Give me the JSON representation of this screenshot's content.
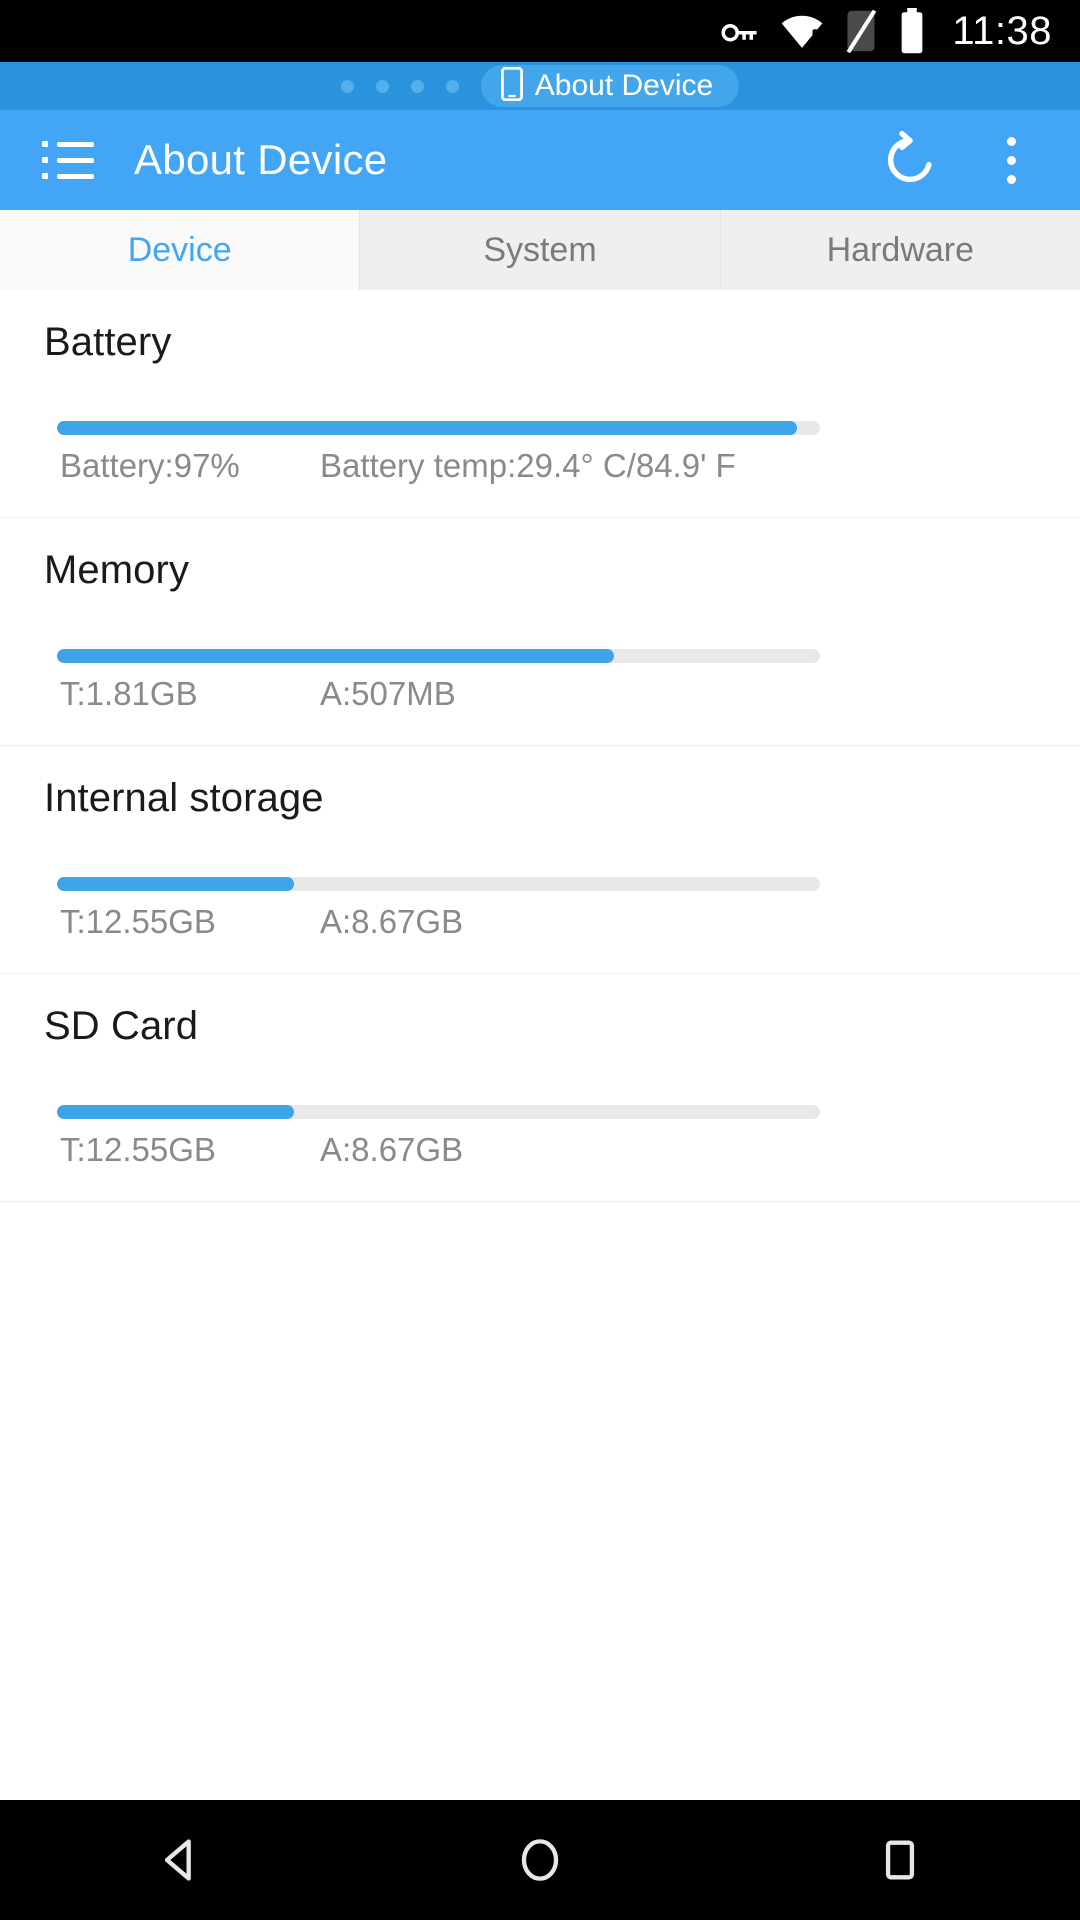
{
  "status_bar": {
    "time": "11:38",
    "icons": [
      "vpn-key-icon",
      "wifi-warning-icon",
      "sim-missing-icon",
      "battery-full-icon"
    ]
  },
  "pill_bar": {
    "dots_count": 4,
    "active_pill": {
      "label": "About Device",
      "icon": "phone-icon"
    }
  },
  "app_bar": {
    "title": "About Device",
    "menu_icon": "list-menu-icon",
    "refresh_icon": "refresh-icon",
    "overflow_icon": "more-vert-icon",
    "accent_color": "#42a5f5"
  },
  "tabs": [
    {
      "label": "Device",
      "selected": true
    },
    {
      "label": "System",
      "selected": false
    },
    {
      "label": "Hardware",
      "selected": false
    }
  ],
  "sections": [
    {
      "title": "Battery",
      "progress_percent": 97,
      "stat_left": "Battery:97%",
      "stat_right": "Battery temp:29.4° C/84.9' F"
    },
    {
      "title": "Memory",
      "progress_percent": 73,
      "stat_left": "T:1.81GB",
      "stat_right": "A:507MB"
    },
    {
      "title": "Internal storage",
      "progress_percent": 31,
      "stat_left": "T:12.55GB",
      "stat_right": "A:8.67GB"
    },
    {
      "title": "SD Card",
      "progress_percent": 31,
      "stat_left": "T:12.55GB",
      "stat_right": "A:8.67GB"
    }
  ],
  "nav_bar": {
    "back": "back-icon",
    "home": "home-icon",
    "recents": "recents-icon"
  },
  "colors": {
    "accent": "#42a5f5",
    "progress_fill": "#3fa3e8",
    "progress_track": "#e8e8e8",
    "tab_selected_text": "#42a5f5",
    "tab_text": "#7a7a7a",
    "stat_text": "#8a8a8a"
  }
}
